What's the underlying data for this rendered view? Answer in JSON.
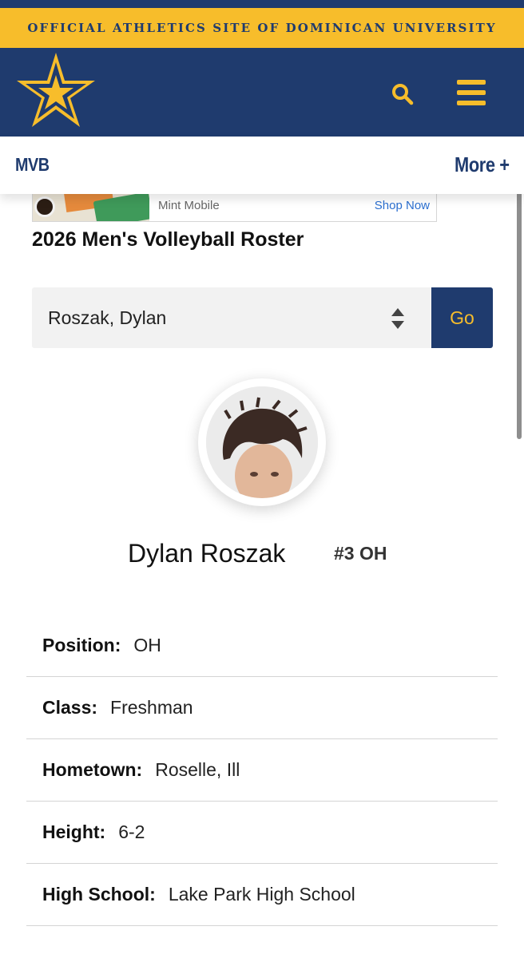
{
  "banner": {
    "text": "OFFICIAL ATHLETICS SITE OF DOMINICAN UNIVERSITY"
  },
  "header": {
    "logo_icon": "star-logo-icon",
    "search_icon": "search-icon",
    "menu_icon": "hamburger-menu-icon"
  },
  "subnav": {
    "sport": "MVB",
    "more": "More +"
  },
  "ad": {
    "brand": "Mint Mobile",
    "cta": "Shop Now"
  },
  "page": {
    "title": "2026 Men's Volleyball Roster"
  },
  "player_select": {
    "value": "Roszak, Dylan",
    "go_label": "Go"
  },
  "player": {
    "name": "Dylan Roszak",
    "number_position": "#3 OH"
  },
  "bio": [
    {
      "label": "Position:",
      "value": "OH"
    },
    {
      "label": "Class:",
      "value": "Freshman"
    },
    {
      "label": "Hometown:",
      "value": "Roselle, Ill"
    },
    {
      "label": "Height:",
      "value": "6-2"
    },
    {
      "label": "High School:",
      "value": "Lake Park High School"
    }
  ],
  "colors": {
    "navy": "#1f3b6e",
    "gold": "#f7bd2b"
  }
}
